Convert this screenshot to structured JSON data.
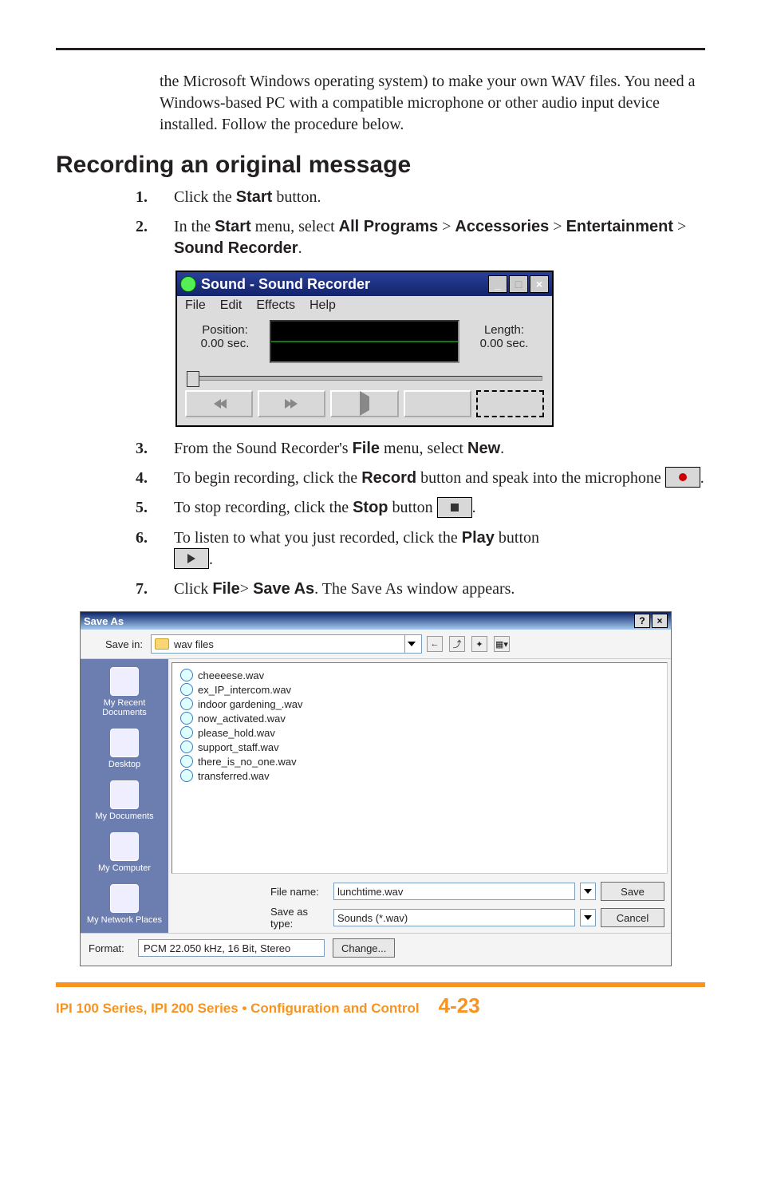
{
  "intro": "the Microsoft Windows operating system) to make your own WAV files. You need a Windows-based PC with a compatible microphone or other audio input device installed.  Follow the procedure below.",
  "section_heading": "Recording an original message",
  "steps": {
    "s1_pre": "Click the ",
    "s1_b": "Start",
    "s1_post": " button.",
    "s2_a": "In the ",
    "s2_b": "Start",
    "s2_c": " menu, select ",
    "s2_d": "All Programs",
    "s2_e": " > ",
    "s2_f": "Accessories",
    "s2_g": " > ",
    "s2_h": "Entertainment",
    "s2_i": " > ",
    "s2_j": "Sound Recorder",
    "s2_k": ".",
    "s3_a": "From the Sound Recorder's ",
    "s3_b": "File",
    "s3_c": " menu, select ",
    "s3_d": "New",
    "s3_e": ".",
    "s4_a": "To begin recording, click the ",
    "s4_b": "Record",
    "s4_c": " button and speak into the microphone ",
    "s4_d": ".",
    "s5_a": "To stop recording, click the ",
    "s5_b": "Stop",
    "s5_c": " button ",
    "s5_d": ".",
    "s6_a": "To listen to what you just recorded, click the ",
    "s6_b": "Play",
    "s6_c": " button ",
    "s6_d": ".",
    "s7_a": "Click ",
    "s7_b": "File",
    "s7_c": "> ",
    "s7_d": "Save As",
    "s7_e": ".  The Save As window appears."
  },
  "nums": {
    "n1": "1.",
    "n2": "2.",
    "n3": "3.",
    "n4": "4.",
    "n5": "5.",
    "n6": "6.",
    "n7": "7."
  },
  "sound_recorder": {
    "title": "Sound - Sound Recorder",
    "menu": {
      "file": "File",
      "edit": "Edit",
      "effects": "Effects",
      "help": "Help"
    },
    "position_label": "Position:",
    "position_value": "0.00 sec.",
    "length_label": "Length:",
    "length_value": "0.00 sec."
  },
  "save_as": {
    "title": "Save As",
    "save_in_label": "Save in:",
    "save_in_value": "wav files",
    "places": {
      "recent": "My Recent Documents",
      "desktop": "Desktop",
      "mydocs": "My Documents",
      "mycomp": "My Computer",
      "mynet": "My Network Places"
    },
    "files": [
      "cheeeese.wav",
      "ex_IP_intercom.wav",
      "indoor gardening_.wav",
      "now_activated.wav",
      "please_hold.wav",
      "support_staff.wav",
      "there_is_no_one.wav",
      "transferred.wav"
    ],
    "filename_label": "File name:",
    "filename_value": "lunchtime.wav",
    "saveastype_label": "Save as type:",
    "saveastype_value": "Sounds (*.wav)",
    "save_btn": "Save",
    "cancel_btn": "Cancel",
    "format_label": "Format:",
    "format_value": "PCM 22.050 kHz, 16 Bit, Stereo",
    "change_btn": "Change..."
  },
  "footer": {
    "text": "IPI 100 Series, IPI 200 Series • Configuration and Control",
    "page": "4-23"
  }
}
